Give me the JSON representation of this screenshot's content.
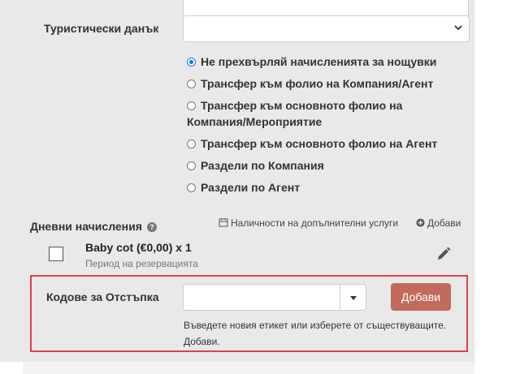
{
  "tourist_tax": {
    "label": "Туристически данък",
    "selected_value": ""
  },
  "transfer_options": [
    {
      "label": "Не прехвърляй начисленията за нощувки",
      "checked": true
    },
    {
      "label": "Трансфер към фолио на Компания/Агент",
      "checked": false
    },
    {
      "label": "Трансфер към основното фолио на Компания/Мероприятие",
      "checked": false
    },
    {
      "label": "Трансфер към основното фолио на Агент",
      "checked": false
    },
    {
      "label": "Раздели по Компания",
      "checked": false
    },
    {
      "label": "Раздели по Агент",
      "checked": false
    }
  ],
  "daily_charges": {
    "label": "Дневни начисления",
    "help_icon": "?",
    "availability_link": "Наличности на допълнителни услуги",
    "add_link": "Добави",
    "items": [
      {
        "title": "Baby cot (€0,00) x 1",
        "subtitle": "Период на резервацията",
        "checked": false
      }
    ]
  },
  "discount_codes": {
    "label": "Кодове за Отстъпка",
    "input_value": "",
    "add_button": "Добави",
    "hint": "Въведете новия етикет или изберете от съществуващите. Добави."
  },
  "colors": {
    "panel_bg": "#e9e9e9",
    "accent_radio": "#1a73e8",
    "add_button_bg": "#c26a5c",
    "highlight_border": "#e0404a"
  }
}
